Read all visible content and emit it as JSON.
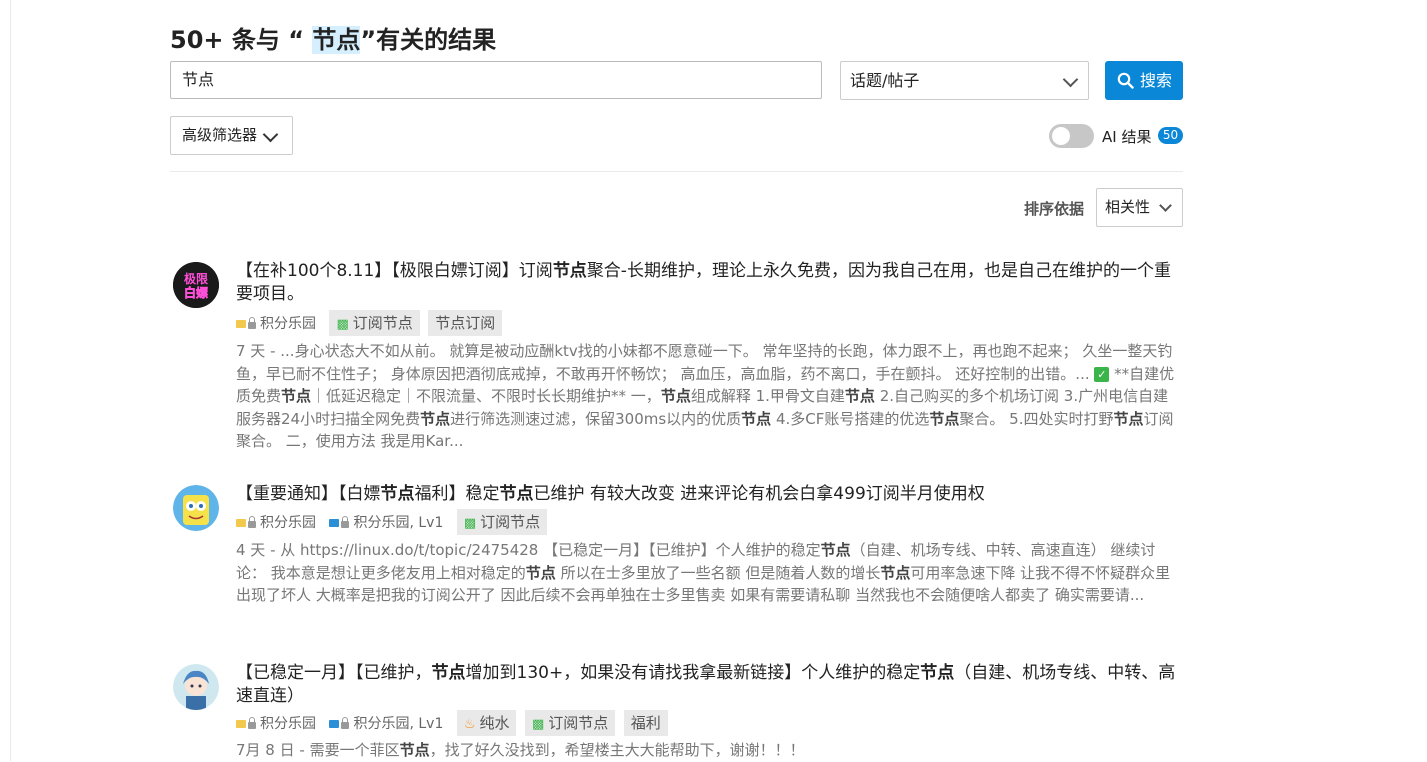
{
  "header": {
    "title_prefix": "50+ 条与 “ ",
    "title_term": "节点",
    "title_suffix": "”有关的结果"
  },
  "search": {
    "value": "节点",
    "scope_value": "话题/帖子",
    "button_label": "搜索"
  },
  "filters": {
    "advanced_label": "高级筛选器",
    "ai_label": "AI 结果",
    "ai_count": "50",
    "ai_enabled": false,
    "sort_label": "排序依据",
    "sort_value": "相关性"
  },
  "colors": {
    "accent": "#0a87d7",
    "category_yellow": "#f2c94c",
    "category_blue": "#2a8fd6",
    "tag_green": "#3bb54a",
    "tag_orange": "#f0932b"
  },
  "results": [
    {
      "title_parts": [
        "【在补100个8.11】【极限白嫖订阅】订阅",
        "节点",
        "聚合-长期维护，理论上永久免费，因为我自己在用，也是自己在维护的一个重要项目。"
      ],
      "avatar_text": "极限白嫖",
      "categories": [
        {
          "color": "#f2c94c",
          "label": "积分乐园"
        }
      ],
      "tags": [
        {
          "icon": "sitemap-icon",
          "label": "订阅节点"
        },
        {
          "icon": "",
          "label": "节点订阅"
        }
      ],
      "excerpt_date": "7 天 - ",
      "excerpt_parts": [
        "...身心状态大不如从前。 就算是被动应酬ktv找的小妹都不愿意碰一下。 常年坚持的长跑，体力跟不上，再也跑不起来； 久坐一整天钓鱼，早已耐不住性子； 身体原因把酒彻底戒掉，不敢再开怀畅饮； 高血压，高血脂，药不离口，手在颤抖。 还好控制的出错。... ",
        " **自建优质免费",
        "节点",
        "｜低延迟稳定｜不限流量、不限时长长期维护** 一，",
        "节点",
        "组成解释 1.甲骨文自建",
        "节点",
        " 2.自己购买的多个机场订阅 3.广州电信自建服务器24小时扫描全网免费",
        "节点",
        "进行筛选测速过滤，保留300ms以内的优质",
        "节点",
        " 4.多CF账号搭建的优选",
        "节点",
        "聚合。 5.四处实时打野",
        "节点",
        "订阅聚合。 二，使用方法 我是用Kar..."
      ]
    },
    {
      "title_parts": [
        "【重要通知】【白嫖",
        "节点",
        "福利】稳定",
        "节点",
        "已维护 有较大改变 进来评论有机会白拿499订阅半月使用权"
      ],
      "categories": [
        {
          "color": "#f2c94c",
          "label": "积分乐园"
        },
        {
          "color": "#2a8fd6",
          "label": "积分乐园, Lv1"
        }
      ],
      "tags": [
        {
          "icon": "sitemap-icon",
          "label": "订阅节点"
        }
      ],
      "excerpt_date": "4 天 - ",
      "excerpt_parts": [
        "从 https://linux.do/t/topic/2475428 【已稳定一月】【已维护】个人维护的稳定",
        "节点",
        "（自建、机场专线、中转、高速直连） 继续讨论： 我本意是想让更多佬友用上相对稳定的",
        "节点",
        " 所以在士多里放了一些名额 但是随着人数的增长",
        "节点",
        "可用率急速下降 让我不得不怀疑群众里出现了坏人 大概率是把我的订阅公开了 因此后续不会再单独在士多里售卖 如果有需要请私聊 当然我也不会随便啥人都卖了 确实需要请..."
      ]
    },
    {
      "title_parts": [
        "【已稳定一月】【已维护，",
        "节点",
        "增加到130+，如果没有请找我拿最新链接】个人维护的稳定",
        "节点",
        "（自建、机场专线、中转、高速直连）"
      ],
      "categories": [
        {
          "color": "#f2c94c",
          "label": "积分乐园"
        },
        {
          "color": "#2a8fd6",
          "label": "积分乐园, Lv1"
        }
      ],
      "tags": [
        {
          "icon": "faucet-icon",
          "label": "纯水"
        },
        {
          "icon": "sitemap-icon",
          "label": "订阅节点"
        },
        {
          "icon": "",
          "label": "福利"
        }
      ],
      "excerpt_date": "7月 8 日 - ",
      "excerpt_parts": [
        "需要一个菲区",
        "节点",
        "，找了好久没找到，希望楼主大大能帮助下，谢谢！！！"
      ]
    }
  ]
}
